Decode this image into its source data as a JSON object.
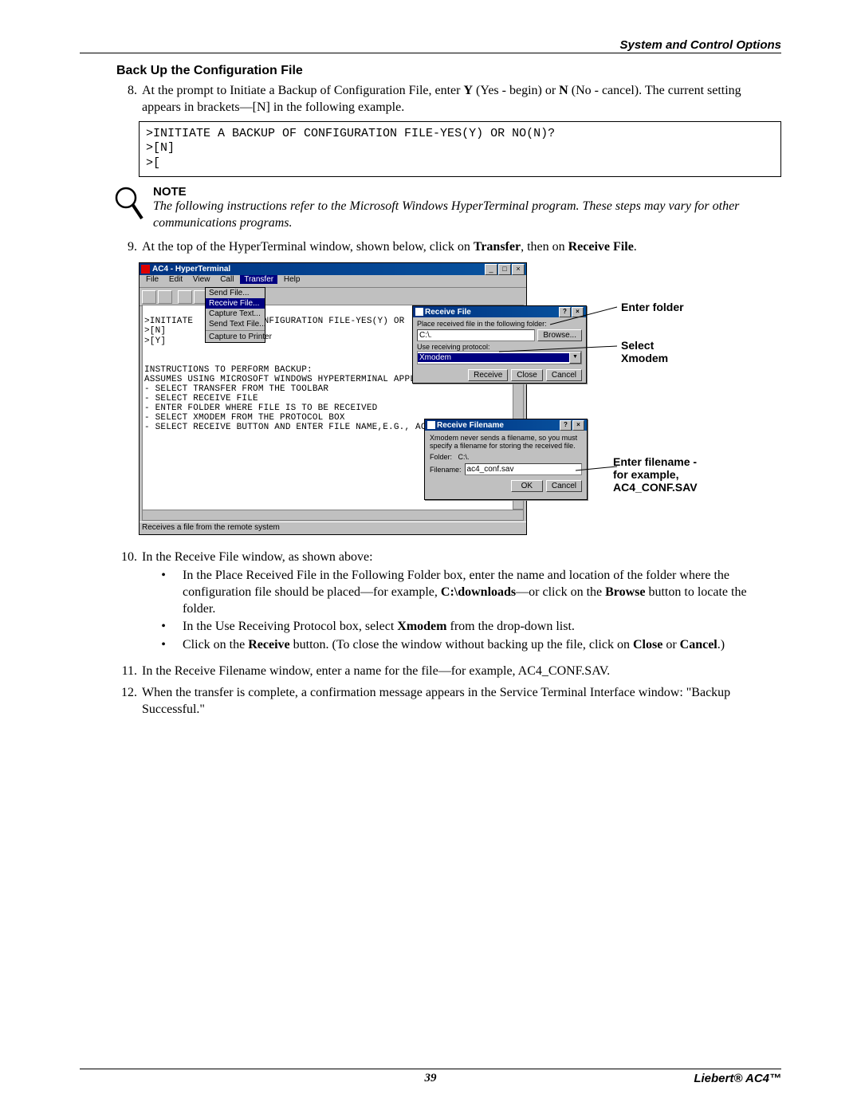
{
  "header": {
    "right": "System and Control Options"
  },
  "section_title": "Back Up the Configuration File",
  "step8": {
    "num": "8.",
    "text_pre": "At the prompt to Initiate a Backup of Configuration File, enter ",
    "y": "Y",
    "y_desc": " (Yes - begin) or ",
    "n": "N",
    "n_desc": " (No - cancel). The current setting appears in brackets—[N] in the following example."
  },
  "code_block": ">INITIATE A BACKUP OF CONFIGURATION FILE-YES(Y) OR NO(N)?\n>[N]\n>[",
  "note": {
    "title": "NOTE",
    "body": "The following instructions refer to the Microsoft Windows HyperTerminal program. These steps may vary for other communications programs."
  },
  "step9": {
    "num": "9.",
    "text_pre": "At the top of the HyperTerminal window, shown below, click on ",
    "b1": "Transfer",
    "mid": ", then on ",
    "b2": "Receive File",
    "end": "."
  },
  "hyperterminal": {
    "title": "AC4 - HyperTerminal",
    "menu": [
      "File",
      "Edit",
      "View",
      "Call",
      "Transfer",
      "Help"
    ],
    "dropdown": [
      "Send File...",
      "Receive File...",
      "Capture Text...",
      "Send Text File...",
      "Capture to Printer"
    ],
    "terminal_lines": [
      "",
      ">INITIATE            DNFIGURATION FILE-YES(Y) OR",
      ">[N]",
      ">[Y]",
      "",
      "",
      "INSTRUCTIONS TO PERFORM BACKUP:",
      "ASSUMES USING MICROSOFT WINDOWS HYPERTERMINAL APPLI",
      "- SELECT TRANSFER FROM THE TOOLBAR",
      "- SELECT RECEIVE FILE",
      "- ENTER FOLDER WHERE FILE IS TO BE RECEIVED",
      "- SELECT XMODEM FROM THE PROTOCOL BOX",
      "- SELECT RECEIVE BUTTON AND ENTER FILE NAME,E.G., AC4_CONF.SAV"
    ],
    "status": "Receives a file from the remote system"
  },
  "receive_file_dlg": {
    "title": "Receive File",
    "label1": "Place received file in the following folder:",
    "folder_value": "C:\\.",
    "browse": "Browse...",
    "label2": "Use receiving protocol:",
    "protocol": "Xmodem",
    "btn_receive": "Receive",
    "btn_close": "Close",
    "btn_cancel": "Cancel"
  },
  "receive_filename_dlg": {
    "title": "Receive Filename",
    "msg": "Xmodem never sends a filename, so you must specify a filename for storing the received file.",
    "folder_lbl": "Folder:",
    "folder_val": "C:\\.",
    "filename_lbl": "Filename:",
    "filename_val": "ac4_conf.sav",
    "btn_ok": "OK",
    "btn_cancel": "Cancel"
  },
  "callouts": {
    "enter_folder": "Enter folder",
    "select_xmodem_l1": "Select",
    "select_xmodem_l2": "Xmodem",
    "enter_filename_l1": "Enter filename -",
    "enter_filename_l2": "for example,",
    "enter_filename_l3": "AC4_CONF.SAV"
  },
  "step10": {
    "num": "10.",
    "intro": "In the Receive File window, as shown above:",
    "b1_pre": "In the Place Received File in the Following Folder box, enter the name and location of the folder where the configuration file should be placed—for example, ",
    "b1_bold": "C:\\downloads",
    "b1_mid": "—or click on the ",
    "b1_bold2": "Browse",
    "b1_end": " button to locate the folder.",
    "b2_pre": "In the Use Receiving Protocol box, select ",
    "b2_bold": "Xmodem",
    "b2_end": " from the drop-down list.",
    "b3_pre": "Click on the ",
    "b3_bold": "Receive",
    "b3_mid": " button. (To close the window without backing up the file, click on ",
    "b3_bold2": "Close",
    "b3_mid2": " or ",
    "b3_bold3": "Cancel",
    "b3_end": ".)"
  },
  "step11": {
    "num": "11.",
    "text": "In the Receive Filename window, enter a name for the file—for example, AC4_CONF.SAV."
  },
  "step12": {
    "num": "12.",
    "text": "When the transfer is complete, a confirmation message appears in the Service Terminal Interface window: \"Backup Successful.\""
  },
  "footer": {
    "page": "39",
    "product": "Liebert® AC4™"
  }
}
